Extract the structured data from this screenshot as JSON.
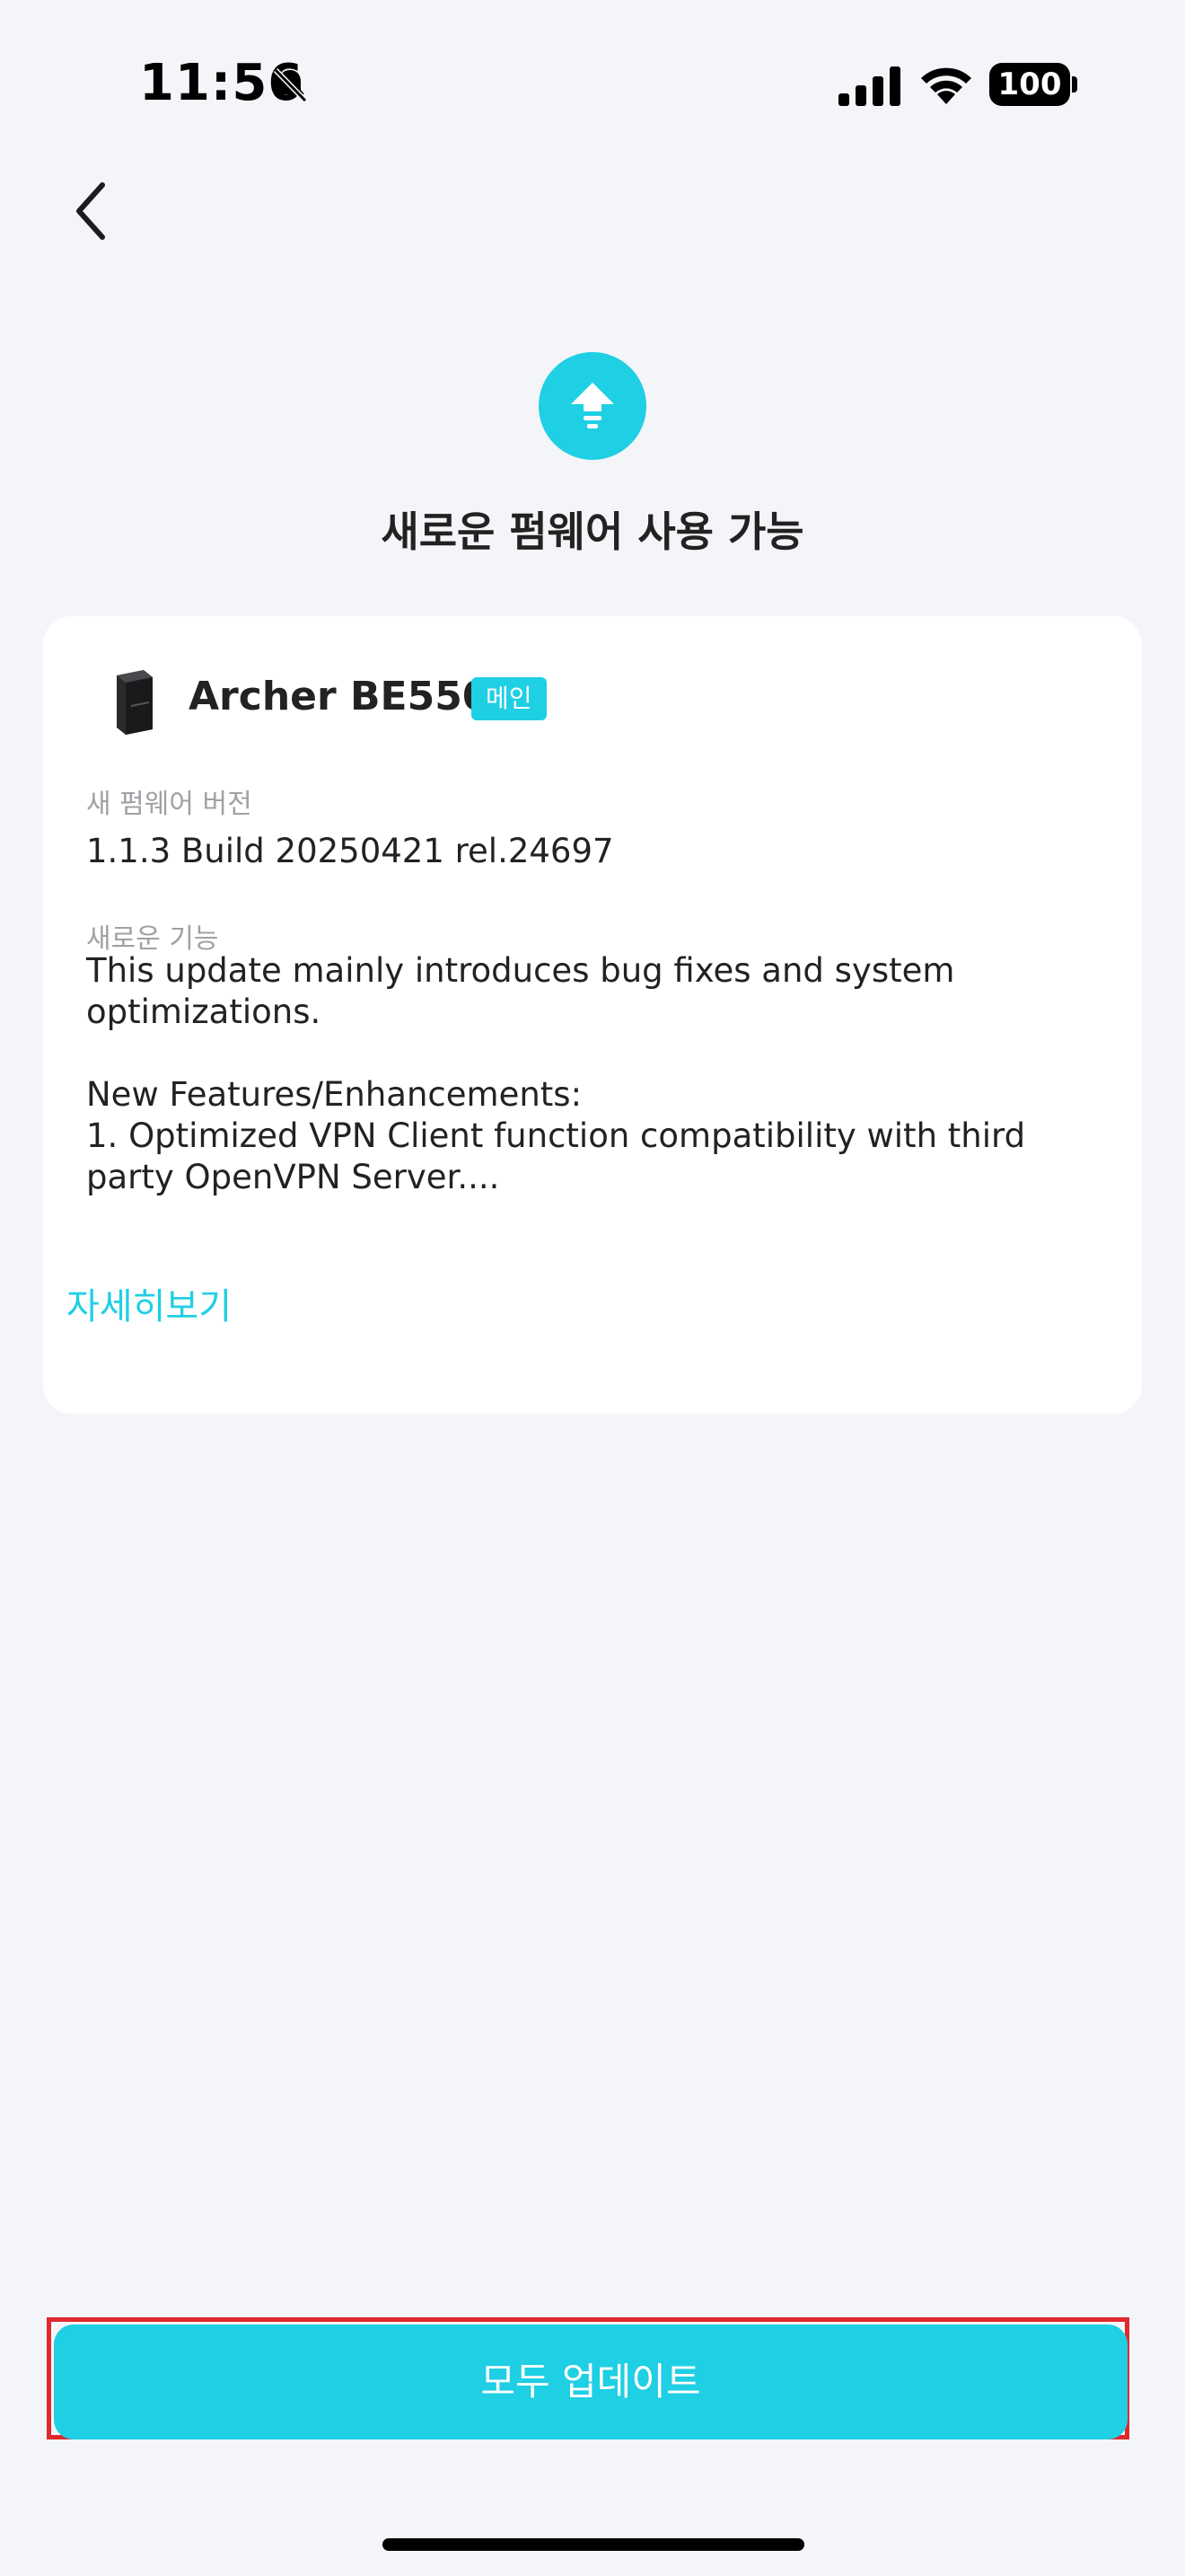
{
  "status_bar": {
    "time": "11:56",
    "battery": "100"
  },
  "page": {
    "title": "새로운 펌웨어 사용 가능"
  },
  "device": {
    "name": "Archer BE550",
    "badge": "메인"
  },
  "firmware": {
    "version_label": "새 펌웨어 버전",
    "version": "1.1.3 Build 20250421 rel.24697",
    "features_label": "새로운 기능",
    "features_text": "This update mainly introduces bug fixes and system optimizations.\n\nNew Features/Enhancements:\n1. Optimized VPN Client function compatibility with third party OpenVPN Server...."
  },
  "links": {
    "more": "자세히보기"
  },
  "actions": {
    "update_all": "모두 업데이트"
  },
  "colors": {
    "accent": "#1fcfe4",
    "background": "#f4f5f9",
    "highlight_border": "#e0282d"
  }
}
